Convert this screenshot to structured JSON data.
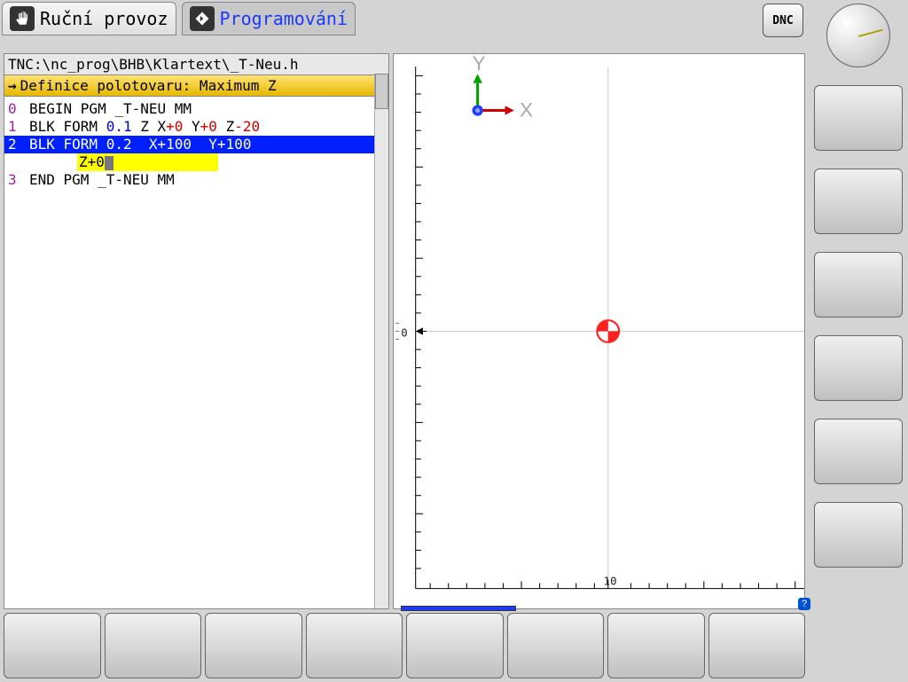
{
  "tabs": {
    "manual": "Ruční provoz",
    "programming": "Programování"
  },
  "dnc": "DNC",
  "editor": {
    "file_path": "TNC:\\nc_prog\\BHB\\Klartext\\_T-Neu.h",
    "prompt": "Definice polotovaru: Maximum Z",
    "lines": {
      "l0": {
        "n": "0",
        "a": "BEGIN PGM _T-NEU MM"
      },
      "l1": {
        "n": "1",
        "a": "BLK FORM ",
        "b": "0.1",
        "c": " Z X",
        "d": "+0",
        "e": " Y",
        "f": "+0",
        "g": " Z",
        "h": "-20"
      },
      "l2": {
        "n": "2",
        "a": "BLK FORM 0.2  X+100  Y+100"
      },
      "l2b": {
        "z": "Z+0"
      },
      "l3": {
        "n": "3",
        "a": "END PGM _T-NEU MM"
      }
    }
  },
  "axes": {
    "x": "X",
    "y": "Y",
    "zero": "0",
    "ten": "10"
  },
  "help": "?"
}
